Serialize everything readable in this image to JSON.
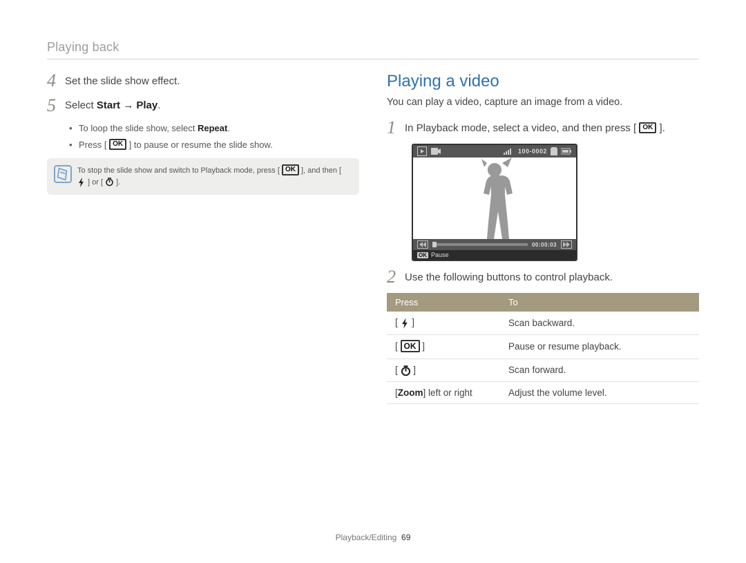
{
  "header": "Playing back",
  "left": {
    "step4": {
      "num": "4",
      "text": "Set the slide show effect."
    },
    "step5": {
      "num": "5",
      "pre": "Select ",
      "bold": "Start → Play",
      "post": ".",
      "bullets": {
        "b1a": "To loop the slide show, select ",
        "b1b": "Repeat",
        "b1c": ".",
        "b2a": "Press [ ",
        "b2ok": "OK",
        "b2b": " ] to pause or resume the slide show."
      }
    },
    "note": {
      "a": "To stop the slide show and switch to Playback mode, press [ ",
      "ok": "OK",
      "b": " ], and then [ ",
      "c": " ] or [ ",
      "d": " ]."
    }
  },
  "right": {
    "title": "Playing a video",
    "intro": "You can play a video, capture an image from a video.",
    "step1": {
      "num": "1",
      "a": "In Playback mode, select a video, and then press [ ",
      "ok": "OK",
      "b": " ]."
    },
    "preview": {
      "file": "100-0002",
      "time": "00:00:03",
      "ok": "OK",
      "pause": "Pause"
    },
    "step2": {
      "num": "2",
      "text": "Use the following buttons to control playback."
    },
    "table": {
      "h1": "Press",
      "h2": "To",
      "r1": {
        "k": "",
        "v": "Scan backward."
      },
      "r2": {
        "k": "OK",
        "v": "Pause or resume playback."
      },
      "r3": {
        "k": "",
        "v": "Scan forward."
      },
      "r4": {
        "ka": "[",
        "kb": "Zoom",
        "kc": "] left or right",
        "v": "Adjust the volume level."
      }
    }
  },
  "footer": {
    "section": "Playback/Editing",
    "page": "69"
  }
}
